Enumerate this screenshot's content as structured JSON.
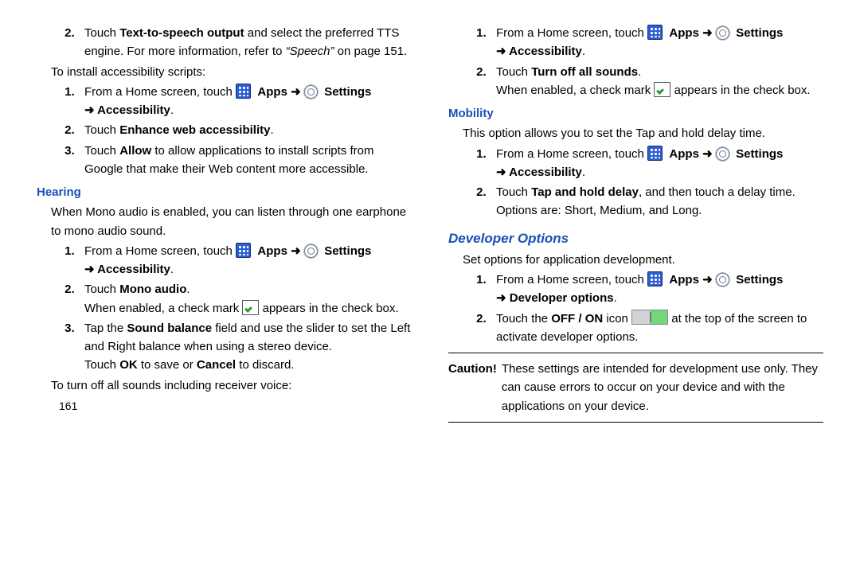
{
  "page_number": "161",
  "left": {
    "tts_step": {
      "num": "2",
      "prefix": "Touch ",
      "b1": "Text-to-speech output",
      "mid": " and select the preferred TTS engine. For more information, refer to ",
      "ref": "“Speech”",
      "suffix": " on page 151."
    },
    "install_intro": "To install accessibility scripts:",
    "s1": {
      "num": "1",
      "a": "From a Home screen, touch ",
      "apps": "Apps",
      "arr": "➜",
      "settings": "Settings",
      "line2": "➜ Accessibility",
      "dot": "."
    },
    "s2": {
      "num": "2",
      "a": "Touch ",
      "b": "Enhance web accessibility",
      "dot": "."
    },
    "s3": {
      "num": "3",
      "a": "Touch ",
      "b": "Allow",
      "c": " to allow applications to install scripts from Google that make their Web content more accessible."
    },
    "hearing_title": "Hearing",
    "hearing_intro": "When Mono audio is enabled, you can listen through one earphone to mono audio sound.",
    "h1": {
      "num": "1",
      "a": "From a Home screen, touch ",
      "apps": "Apps",
      "arr": "➜",
      "settings": "Settings",
      "line2": "➜ Accessibility",
      "dot": "."
    },
    "h2": {
      "num": "2",
      "a": "Touch ",
      "b": "Mono audio",
      "dot": ".",
      "note_a": "When enabled, a check mark ",
      "note_b": " appears in the check box."
    },
    "h3": {
      "num": "3",
      "a": "Tap the ",
      "b": "Sound balance",
      "c": " field and use the slider to set the Left and Right balance when using a stereo device.",
      "d": "Touch ",
      "ok": "OK",
      "e": " to save or ",
      "cancel": "Cancel",
      "f": " to discard."
    },
    "turnoff_intro": "To turn off all sounds including receiver voice:"
  },
  "right": {
    "r1": {
      "num": "1",
      "a": "From a Home screen, touch ",
      "apps": "Apps",
      "arr": "➜",
      "settings": "Settings",
      "line2": "➜ Accessibility",
      "dot": "."
    },
    "r2": {
      "num": "2",
      "a": "Touch ",
      "b": "Turn off all sounds",
      "dot": ".",
      "note_a": "When enabled, a check mark ",
      "note_b": " appears in the check box."
    },
    "mobility_title": "Mobility",
    "mobility_intro": "This option allows you to set the Tap and hold delay time.",
    "m1": {
      "num": "1",
      "a": "From a Home screen, touch ",
      "apps": "Apps",
      "arr": "➜",
      "settings": "Settings",
      "line2": "➜ Accessibility",
      "dot": "."
    },
    "m2": {
      "num": "2",
      "a": "Touch ",
      "b": "Tap and hold delay",
      "c": ", and then touch a delay time. Options are: Short, Medium, and Long."
    },
    "dev_title": "Developer Options",
    "dev_intro": "Set options for application development.",
    "d1": {
      "num": "1",
      "a": "From a Home screen, touch ",
      "apps": "Apps",
      "arr": "➜",
      "settings": "Settings",
      "line2": "➜ Developer options",
      "dot": "."
    },
    "d2": {
      "num": "2",
      "a": "Touch the ",
      "b": "OFF / ON",
      "c": " icon ",
      "d": " at the top of the screen to activate developer options."
    },
    "caution_label": "Caution!",
    "caution_text": "These settings are intended for development use only. They can cause errors to occur on your device and with the applications on your device."
  }
}
